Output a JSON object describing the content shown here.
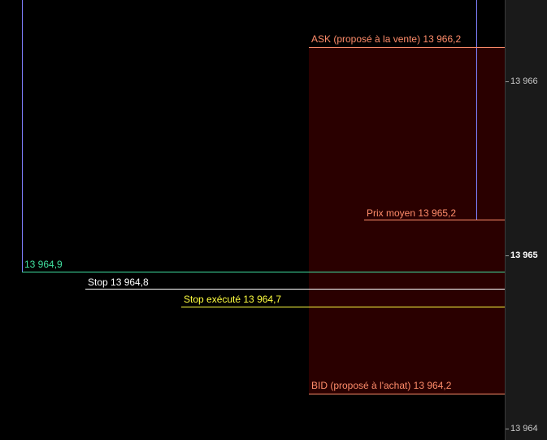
{
  "colors": {
    "background": "#000000",
    "ask_bid": "#ff8c6a",
    "spread_fill": "#2a0000",
    "avg_price": "#ff8c6a",
    "position_line": "#8080ff",
    "entry": "#40e0a0",
    "stop": "#ffffff",
    "stop_executed": "#ffff40"
  },
  "lines": {
    "ask": "ASK (proposé à la vente) 13 966,2",
    "avg_price": "Prix moyen 13 965,2",
    "entry": "13 964,9",
    "stop": "Stop 13 964,8",
    "stop_executed": "Stop exécuté 13 964,7",
    "bid": "BID (proposé à l'achat) 13 964,2"
  },
  "axis": {
    "ticks": [
      {
        "label": "13 966",
        "bold": false
      },
      {
        "label": "13 965",
        "bold": true
      },
      {
        "label": "13 964",
        "bold": false
      }
    ]
  }
}
